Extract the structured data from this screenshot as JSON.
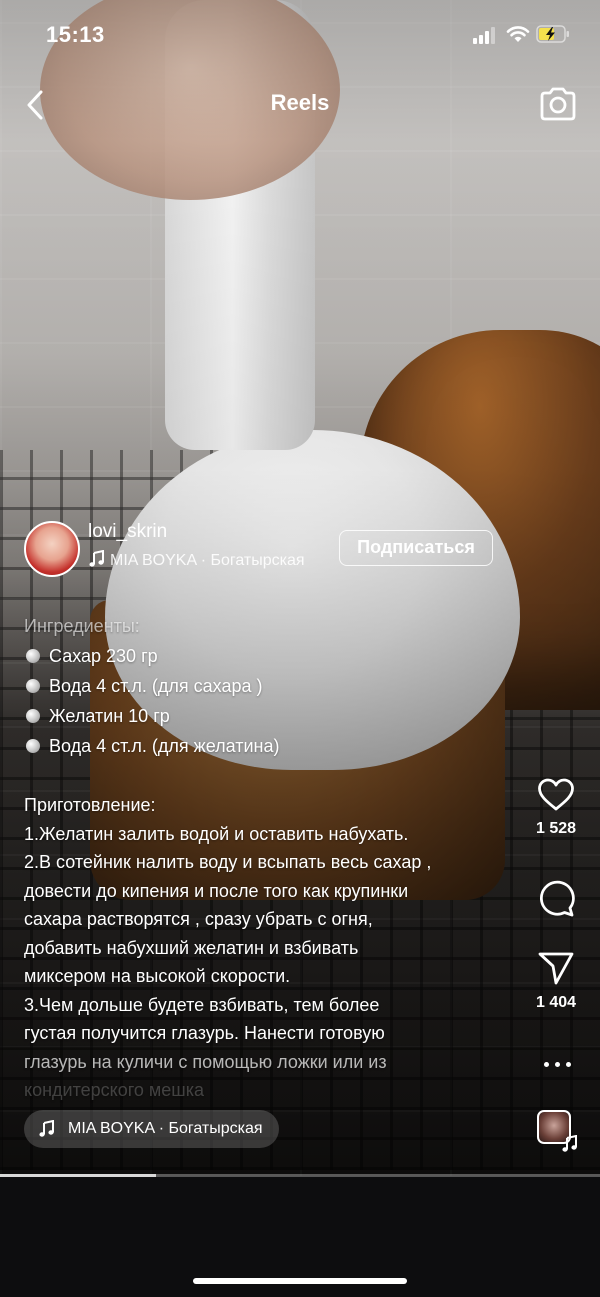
{
  "status_bar": {
    "time": "15:13"
  },
  "header": {
    "title": "Reels"
  },
  "author": {
    "username": "lovi_skrin",
    "audio": "MIA BOYKA · Богатырская",
    "subscribe_label": "Подписаться"
  },
  "caption": {
    "ingredients_title": "Ингредиенты:",
    "ingredients": [
      "Сахар 230 гр",
      "Вода 4 ст.л. (для сахара )",
      "Желатин 10 гр",
      "Вода 4 ст.л. (для желатина)"
    ],
    "prep_title": "Приготовление:",
    "prep_lines": [
      "1.Желатин залить водой и оставить набухать.",
      "2.В сотейник налить воду и всыпать весь сахар ,",
      "довести до кипения и после того как крупинки",
      "сахара растворятся , сразу убрать с огня,",
      "добавить набухший желатин и взбивать",
      "миксером на высокой скорости.",
      "3.Чем дольше будете взбивать, тем более",
      "густая получится глазурь. Нанести готовую",
      "глазурь на куличи с помощью ложки или из",
      "кондитерского мешка"
    ]
  },
  "actions": {
    "likes": "1 528",
    "shares": "1 404"
  },
  "bottom_audio": {
    "label": "MIA BOYKA · Богатырская"
  },
  "playback": {
    "progress": 0.26
  },
  "icons": {
    "back": "chevron-left-icon",
    "camera": "camera-icon",
    "like": "heart-icon",
    "comment": "comment-icon",
    "share": "send-icon",
    "more": "more-horizontal-icon",
    "music": "music-note-icon"
  }
}
